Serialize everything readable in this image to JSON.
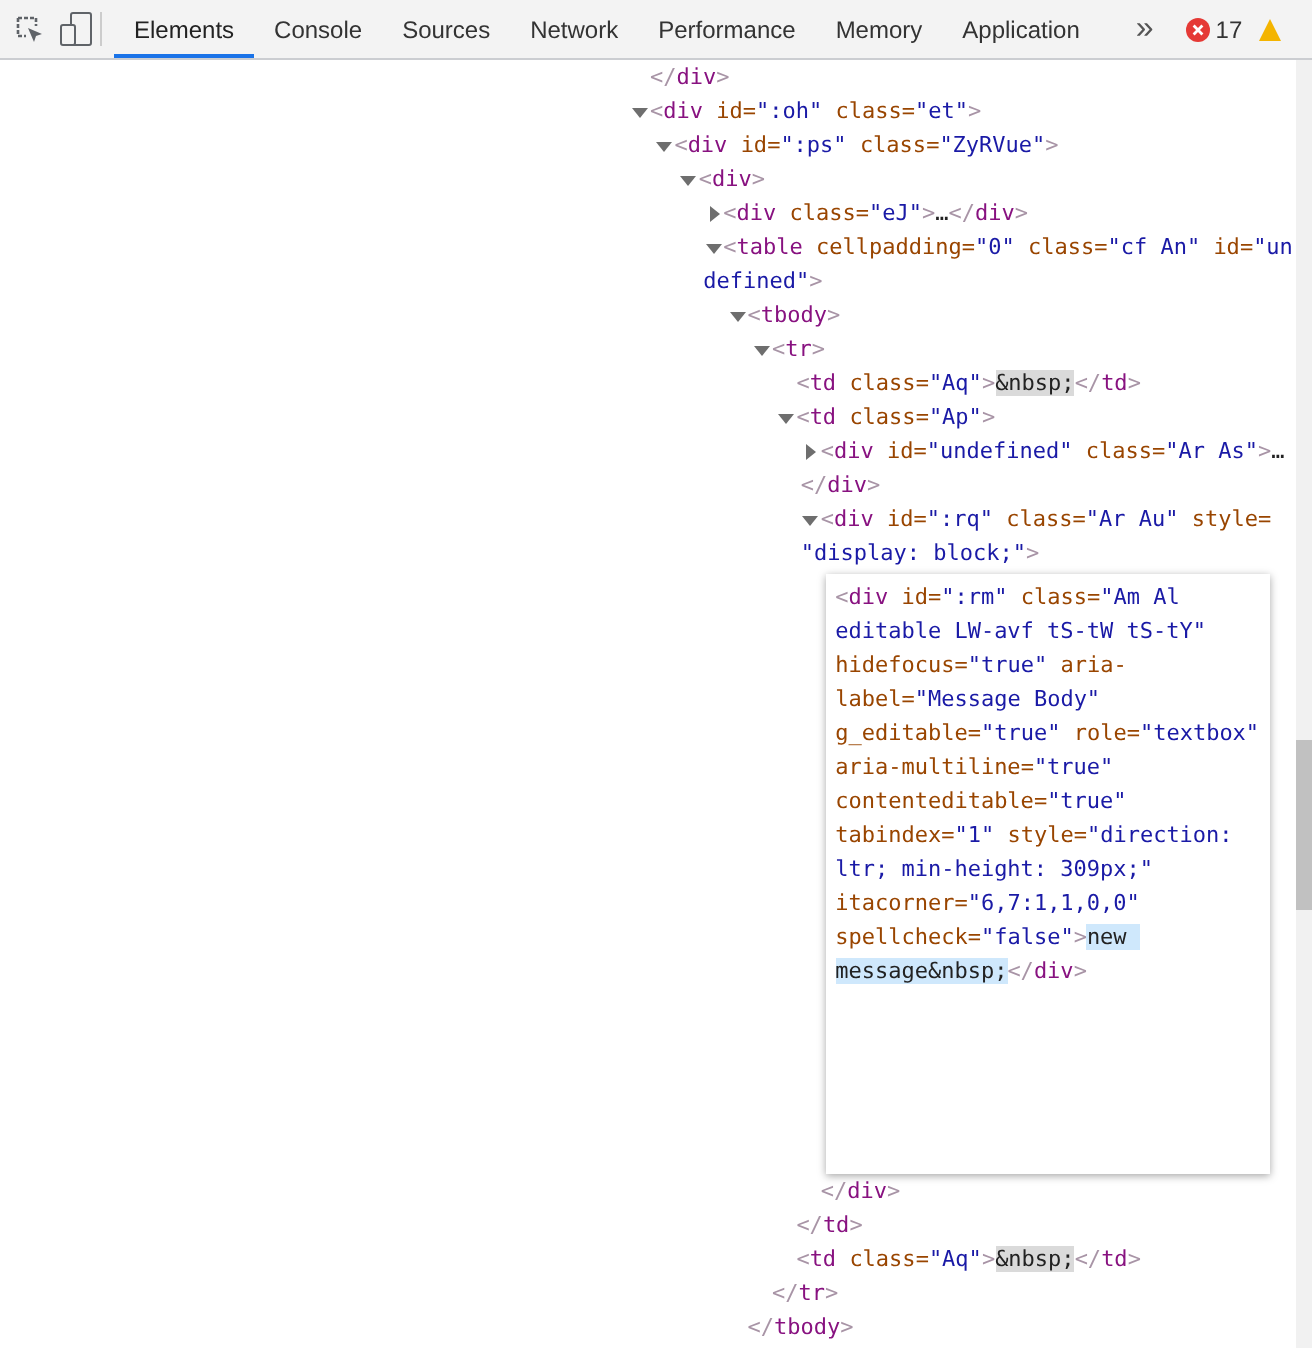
{
  "toolbar": {
    "tabs": [
      {
        "label": "Elements",
        "selected": true
      },
      {
        "label": "Console",
        "selected": false
      },
      {
        "label": "Sources",
        "selected": false
      },
      {
        "label": "Network",
        "selected": false
      },
      {
        "label": "Performance",
        "selected": false
      },
      {
        "label": "Memory",
        "selected": false
      },
      {
        "label": "Application",
        "selected": false
      }
    ],
    "more": "»",
    "error_count": "17"
  },
  "tree": [
    {
      "kind": "element",
      "markup": "</div>"
    },
    {
      "kind": "element",
      "markup": "<div id=\":oh\" class=\"et\">",
      "expanded": true,
      "children": [
        {
          "kind": "element",
          "markup": "<div id=\":ps\" class=\"ZyRVue\">",
          "expanded": true,
          "children": [
            {
              "kind": "element",
              "markup": "<div>",
              "expanded": true,
              "children": [
                {
                  "kind": "element",
                  "markup": "<div class=\"eJ\">…</div>",
                  "expanded": false
                },
                {
                  "kind": "element",
                  "markup": [
                    "<table cellpadding=\"0\" class=\"cf An\" id=\"un",
                    "defined\">"
                  ],
                  "expanded": true,
                  "children": [
                    {
                      "kind": "element",
                      "markup": "<tbody>",
                      "expanded": true,
                      "closing": "</tbody>",
                      "children": [
                        {
                          "kind": "element",
                          "markup": "<tr>",
                          "expanded": true,
                          "closing": "</tr>",
                          "children": [
                            {
                              "kind": "element",
                              "markup": "<td class=\"Aq\">&nbsp;</td>",
                              "text_highlighted": true
                            },
                            {
                              "kind": "element",
                              "markup": "<td class=\"Ap\">",
                              "expanded": true,
                              "closing": "</td>",
                              "children": [
                                {
                                  "kind": "element",
                                  "markup": [
                                    "<div id=\"undefined\" class=\"Ar As\">…",
                                    "</div>"
                                  ],
                                  "expanded": false
                                },
                                {
                                  "kind": "element",
                                  "markup": [
                                    "<div id=\":rq\" class=\"Ar Au\" style=",
                                    "\"display: block;\">"
                                  ],
                                  "expanded": true,
                                  "closing": "</div>",
                                  "children": [
                                    {
                                      "kind": "editor",
                                      "markup": "<div id=\":rm\" class=\"Am Al editable LW-avf tS-tW tS-tY\" hidefocus=\"true\" aria-label=\"Message Body\" g_editable=\"true\" role=\"textbox\" aria-multiline=\"true\" contenteditable=\"true\" tabindex=\"1\" style=\"direction: ltr; min-height: 309px;\" itacorner=\"6,7:1,1,0,0\" spellcheck=\"false\">new message&nbsp;</div>",
                                      "text_selected": true
                                    }
                                  ]
                                }
                              ]
                            },
                            {
                              "kind": "element",
                              "markup": "<td class=\"Aq\">&nbsp;</td>",
                              "text_highlighted": true
                            }
                          ]
                        }
                      ]
                    }
                  ]
                }
              ]
            }
          ]
        }
      ]
    }
  ]
}
